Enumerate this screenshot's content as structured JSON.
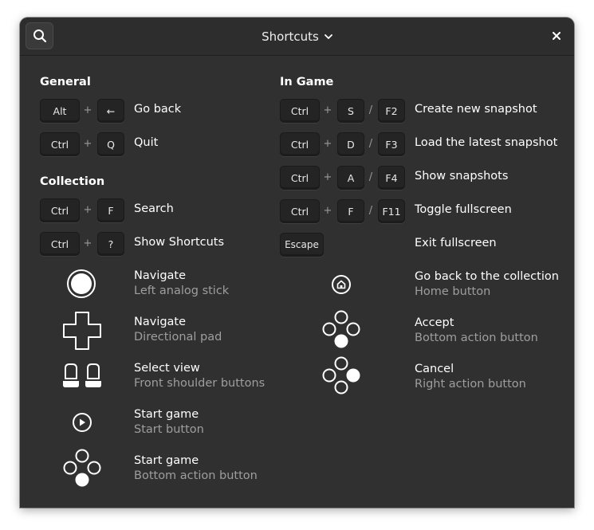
{
  "header": {
    "title": "Shortcuts",
    "search_icon": "search-icon",
    "dropdown_icon": "chevron-down-icon",
    "close_icon": "close-icon"
  },
  "general": {
    "title": "General",
    "go_back": {
      "keys": [
        "Alt",
        "←"
      ],
      "label": "Go back"
    },
    "quit": {
      "keys": [
        "Ctrl",
        "Q"
      ],
      "label": "Quit"
    }
  },
  "collection": {
    "title": "Collection",
    "search": {
      "keys": [
        "Ctrl",
        "F"
      ],
      "label": "Search"
    },
    "show_shortcuts": {
      "keys": [
        "Ctrl",
        "?"
      ],
      "label": "Show Shortcuts"
    },
    "gestures": [
      {
        "label": "Navigate",
        "sublabel": "Left analog stick",
        "icon": "analog-stick-icon"
      },
      {
        "label": "Navigate",
        "sublabel": "Directional pad",
        "icon": "dpad-icon"
      },
      {
        "label": "Select view",
        "sublabel": "Front shoulder buttons",
        "icon": "shoulder-buttons-icon"
      },
      {
        "label": "Start game",
        "sublabel": "Start button",
        "icon": "start-button-icon"
      },
      {
        "label": "Start game",
        "sublabel": "Bottom action button",
        "icon": "bottom-action-button-icon"
      }
    ]
  },
  "in_game": {
    "title": "In Game",
    "plus": "+",
    "slash": "/",
    "create_snapshot": {
      "keys": [
        "Ctrl",
        "S",
        "F2"
      ],
      "label": "Create new snapshot"
    },
    "load_snapshot": {
      "keys": [
        "Ctrl",
        "D",
        "F3"
      ],
      "label": "Load the latest snapshot"
    },
    "show_snapshots": {
      "keys": [
        "Ctrl",
        "A",
        "F4"
      ],
      "label": "Show snapshots"
    },
    "toggle_fullscreen": {
      "keys": [
        "Ctrl",
        "F",
        "F11"
      ],
      "label": "Toggle fullscreen"
    },
    "exit_fullscreen": {
      "keys": [
        "Escape"
      ],
      "label": "Exit fullscreen"
    },
    "gestures": [
      {
        "label": "Go back to the collection",
        "sublabel": "Home button",
        "icon": "home-button-icon"
      },
      {
        "label": "Accept",
        "sublabel": "Bottom action button",
        "icon": "bottom-action-button-icon"
      },
      {
        "label": "Cancel",
        "sublabel": "Right action button",
        "icon": "right-action-button-icon"
      }
    ]
  }
}
